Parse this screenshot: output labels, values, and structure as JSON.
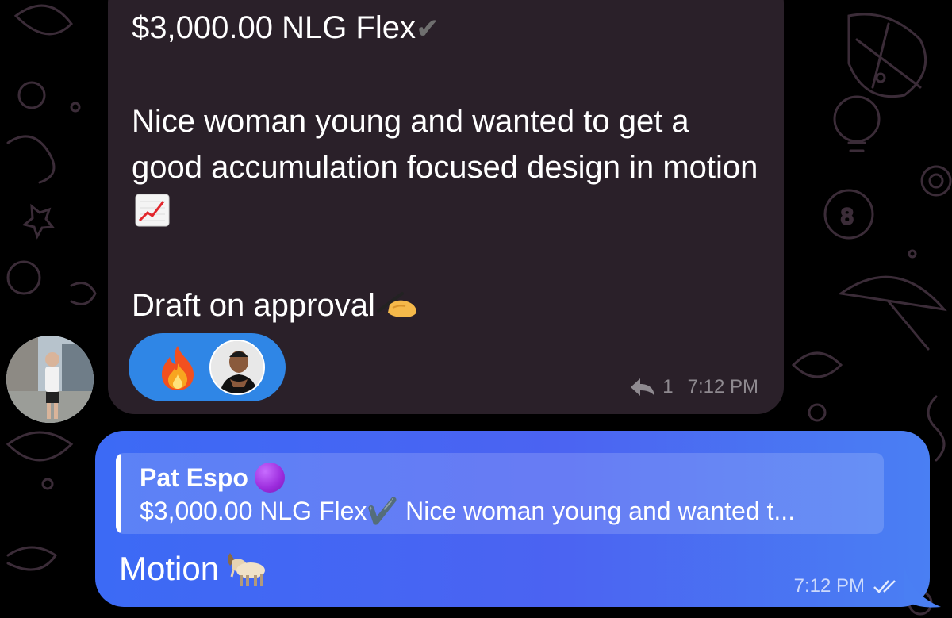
{
  "incoming_message": {
    "line1": "$3,000.00 NLG Flex",
    "line1_check": "✔",
    "line2": "Nice woman young and wanted to get a good accumulation focused design in motion",
    "line3": "Draft on approval",
    "reaction_emoji": "fire-icon",
    "reply_count": "1",
    "time": "7:12 PM"
  },
  "outgoing_message": {
    "reply_to_name": "Pat Espo",
    "reply_to_preview": "$3,000.00 NLG Flex✔️ Nice woman young and wanted t...",
    "text": "Motion",
    "emoji": "goat-icon",
    "time": "7:12 PM",
    "status_icon": "double-check-icon"
  },
  "colors": {
    "background": "#000000",
    "incoming_bubble": "#2a2029",
    "outgoing_bubble": "#4663f2",
    "reaction_pill": "#2f86e6"
  }
}
